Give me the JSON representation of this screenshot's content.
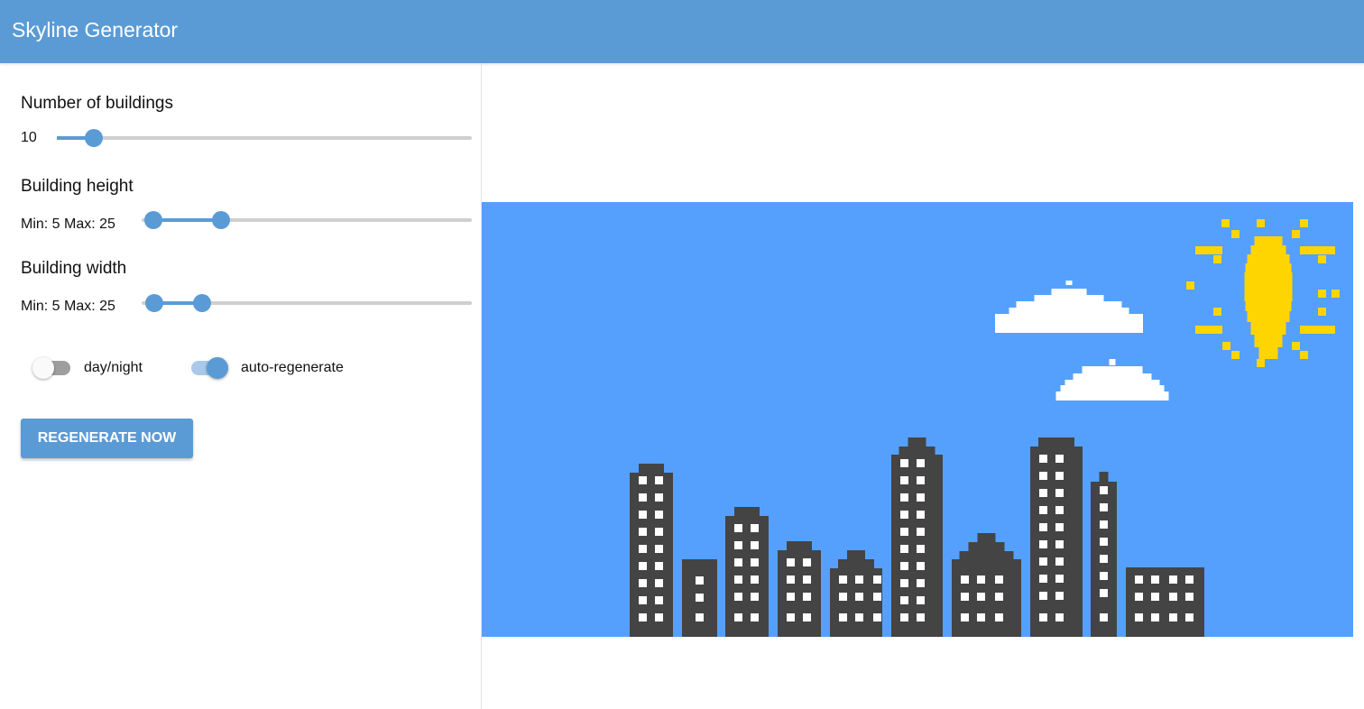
{
  "app": {
    "title": "Skyline Generator"
  },
  "controls": {
    "num_buildings": {
      "label": "Number of buildings",
      "value": "10"
    },
    "building_height": {
      "label": "Building height",
      "range_text": "Min: 5 Max: 25",
      "min": 5,
      "max": 25
    },
    "building_width": {
      "label": "Building width",
      "range_text": "Min: 5 Max: 25",
      "min": 5,
      "max": 25
    },
    "day_night_toggle": {
      "label": "day/night",
      "on": false
    },
    "auto_regenerate_toggle": {
      "label": "auto-regenerate",
      "on": true
    },
    "regenerate_button": {
      "label": "REGENERATE NOW"
    }
  },
  "scene": {
    "sky_color": "#55a0fd",
    "building_color": "#444444",
    "window_color": "#ffffff",
    "sun_color": "#ffd500",
    "cloud_color": "#ffffff"
  }
}
